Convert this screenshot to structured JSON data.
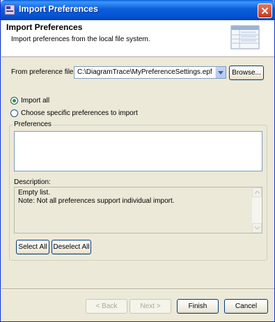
{
  "window": {
    "title": "Import Preferences"
  },
  "banner": {
    "heading": "Import Preferences",
    "description": "Import preferences from the local file system."
  },
  "file": {
    "label": "From preference file:",
    "value": "C:\\DiagramTrace\\MyPreferenceSettings.epf",
    "browse_label": "Browse..."
  },
  "options": {
    "import_all": "Import all",
    "choose_specific": "Choose specific preferences to import",
    "selected": "import_all"
  },
  "preferences": {
    "group_label": "Preferences",
    "items": [],
    "description_label": "Description:",
    "description_line1": "Empty list.",
    "description_line2": "Note: Not all preferences support individual import.",
    "select_all": "Select All",
    "deselect_all": "Deselect All"
  },
  "footer": {
    "back": "< Back",
    "next": "Next >",
    "finish": "Finish",
    "cancel": "Cancel"
  }
}
